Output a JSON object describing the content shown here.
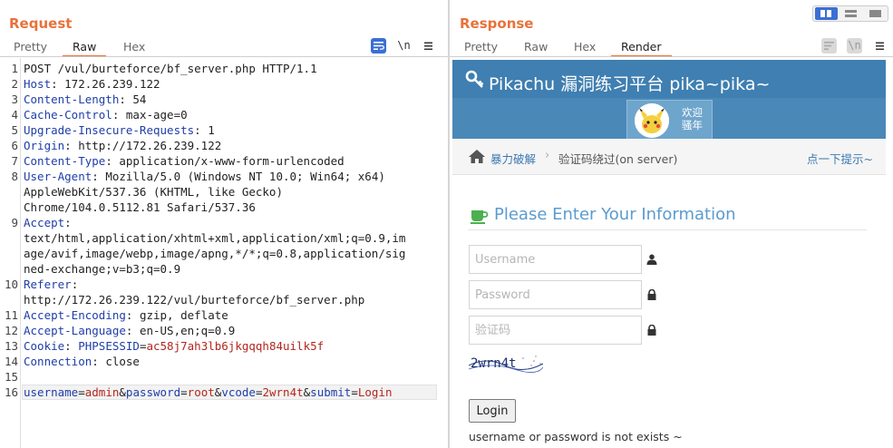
{
  "request": {
    "title": "Request",
    "tabs": [
      "Pretty",
      "Raw",
      "Hex"
    ],
    "active_tab": "Raw",
    "icons": [
      "wrap-lines-icon",
      "newline-toggle-icon",
      "menu-icon"
    ],
    "newline_label": "\\n",
    "line_numbers": [
      "1",
      "2",
      "3",
      "4",
      "5",
      "6",
      "7",
      "8",
      "9",
      "10",
      "11",
      "12",
      "13",
      "14",
      "15",
      "16"
    ],
    "lines": [
      {
        "n": "1",
        "segments": [
          {
            "t": "POST /vul/burteforce/bf_server.php HTTP/1.1",
            "c": ""
          }
        ]
      },
      {
        "n": "2",
        "segments": [
          {
            "t": "Host",
            "c": "hk"
          },
          {
            "t": ": 172.26.239.122",
            "c": ""
          }
        ]
      },
      {
        "n": "3",
        "segments": [
          {
            "t": "Content-Length",
            "c": "hk"
          },
          {
            "t": ": 54",
            "c": ""
          }
        ]
      },
      {
        "n": "4",
        "segments": [
          {
            "t": "Cache-Control",
            "c": "hk"
          },
          {
            "t": ": max-age=0",
            "c": ""
          }
        ]
      },
      {
        "n": "5",
        "segments": [
          {
            "t": "Upgrade-Insecure-Requests",
            "c": "hk"
          },
          {
            "t": ": 1",
            "c": ""
          }
        ]
      },
      {
        "n": "6",
        "segments": [
          {
            "t": "Origin",
            "c": "hk"
          },
          {
            "t": ": http://172.26.239.122",
            "c": ""
          }
        ]
      },
      {
        "n": "7",
        "segments": [
          {
            "t": "Content-Type",
            "c": "hk"
          },
          {
            "t": ": application/x-www-form-urlencoded",
            "c": ""
          }
        ]
      },
      {
        "n": "8",
        "segments": [
          {
            "t": "User-Agent",
            "c": "hk"
          },
          {
            "t": ": Mozilla/5.0 (Windows NT 10.0; Win64; x64)",
            "c": ""
          }
        ]
      },
      {
        "n": "",
        "segments": [
          {
            "t": "AppleWebKit/537.36 (KHTML, like Gecko)",
            "c": ""
          }
        ]
      },
      {
        "n": "",
        "segments": [
          {
            "t": "Chrome/104.0.5112.81 Safari/537.36",
            "c": ""
          }
        ]
      },
      {
        "n": "9",
        "segments": [
          {
            "t": "Accept",
            "c": "hk"
          },
          {
            "t": ":",
            "c": ""
          }
        ]
      },
      {
        "n": "",
        "segments": [
          {
            "t": "text/html,application/xhtml+xml,application/xml;q=0.9,im",
            "c": ""
          }
        ]
      },
      {
        "n": "",
        "segments": [
          {
            "t": "age/avif,image/webp,image/apng,*/*;q=0.8,application/sig",
            "c": ""
          }
        ]
      },
      {
        "n": "",
        "segments": [
          {
            "t": "ned-exchange;v=b3;q=0.9",
            "c": ""
          }
        ]
      },
      {
        "n": "10",
        "segments": [
          {
            "t": "Referer",
            "c": "hk"
          },
          {
            "t": ":",
            "c": ""
          }
        ]
      },
      {
        "n": "",
        "segments": [
          {
            "t": "http://172.26.239.122/vul/burteforce/bf_server.php",
            "c": ""
          }
        ]
      },
      {
        "n": "11",
        "segments": [
          {
            "t": "Accept-Encoding",
            "c": "hk"
          },
          {
            "t": ": gzip, deflate",
            "c": ""
          }
        ]
      },
      {
        "n": "12",
        "segments": [
          {
            "t": "Accept-Language",
            "c": "hk"
          },
          {
            "t": ": en-US,en;q=0.9",
            "c": ""
          }
        ]
      },
      {
        "n": "13",
        "segments": [
          {
            "t": "Cookie",
            "c": "hk"
          },
          {
            "t": ": ",
            "c": ""
          },
          {
            "t": "PHPSESSID",
            "c": "hk"
          },
          {
            "t": "=",
            "c": ""
          },
          {
            "t": "ac58j7ah3lb6jkgqqh84uilk5f",
            "c": "rk"
          }
        ]
      },
      {
        "n": "14",
        "segments": [
          {
            "t": "Connection",
            "c": "hk"
          },
          {
            "t": ": close",
            "c": ""
          }
        ]
      },
      {
        "n": "15",
        "segments": []
      },
      {
        "n": "16",
        "segments": [
          {
            "t": "username",
            "c": "hk"
          },
          {
            "t": "=",
            "c": ""
          },
          {
            "t": "admin",
            "c": "rk"
          },
          {
            "t": "&",
            "c": ""
          },
          {
            "t": "password",
            "c": "hk"
          },
          {
            "t": "=",
            "c": ""
          },
          {
            "t": "root",
            "c": "rk"
          },
          {
            "t": "&",
            "c": ""
          },
          {
            "t": "vcode",
            "c": "hk"
          },
          {
            "t": "=",
            "c": ""
          },
          {
            "t": "2wrn4t",
            "c": "rk"
          },
          {
            "t": "&",
            "c": ""
          },
          {
            "t": "submit",
            "c": "hk"
          },
          {
            "t": "=",
            "c": ""
          },
          {
            "t": "Login",
            "c": "rk"
          }
        ]
      }
    ]
  },
  "response": {
    "title": "Response",
    "tabs": [
      "Pretty",
      "Raw",
      "Hex",
      "Render"
    ],
    "active_tab": "Render",
    "newline_label": "\\n",
    "layout_buttons": [
      "split-horizontal-icon",
      "split-vertical-icon",
      "single-pane-icon"
    ],
    "render": {
      "site_title": "Pikachu 漏洞练习平台 pika~pika~",
      "welcome_line1": "欢迎",
      "welcome_line2": "骚年",
      "breadcrumb_parent": "暴力破解",
      "breadcrumb_current": "验证码绕过(on server)",
      "hint_link": "点一下提示~",
      "heading": "Please Enter Your Information",
      "username_placeholder": "Username",
      "password_placeholder": "Password",
      "vcode_placeholder": "验证码",
      "captcha_text": "2wrn4t",
      "login_label": "Login",
      "message": "username or password is not exists ~"
    }
  },
  "colors": {
    "accent": "#e8723a",
    "header_key": "#1f3ea8",
    "value_red": "#b3261e",
    "site_blue": "#3f7fb1"
  }
}
